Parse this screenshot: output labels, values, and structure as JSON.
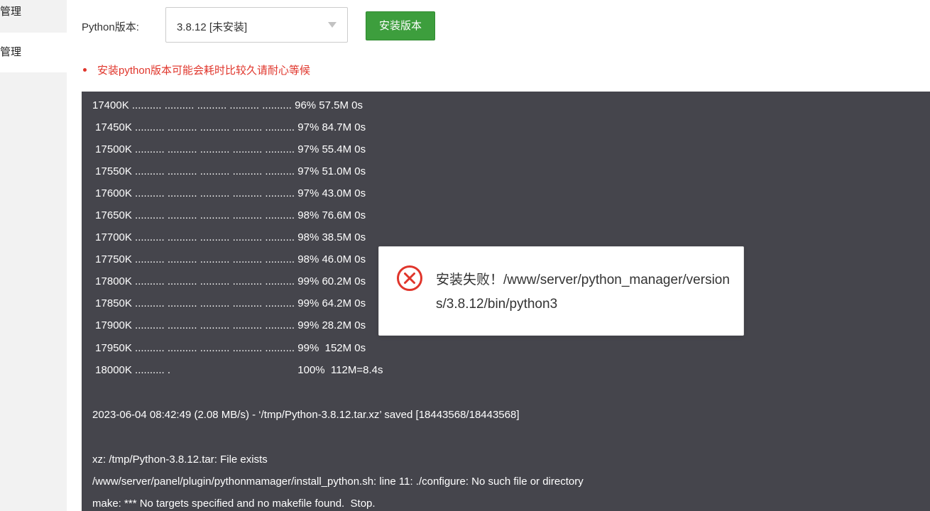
{
  "sidebar": {
    "items": [
      {
        "label": "管理"
      },
      {
        "label": "管理"
      }
    ]
  },
  "version": {
    "label": "Python版本:",
    "selected": "3.8.12  [未安装]",
    "install_button": "安装版本"
  },
  "tip": "安装python版本可能会耗时比较久请耐心等候",
  "log": {
    "lines": [
      "17400K .......... .......... .......... .......... .......... 96% 57.5M 0s",
      " 17450K .......... .......... .......... .......... .......... 97% 84.7M 0s",
      " 17500K .......... .......... .......... .......... .......... 97% 55.4M 0s",
      " 17550K .......... .......... .......... .......... .......... 97% 51.0M 0s",
      " 17600K .......... .......... .......... .......... .......... 97% 43.0M 0s",
      " 17650K .......... .......... .......... .......... .......... 98% 76.6M 0s",
      " 17700K .......... .......... .......... .......... .......... 98% 38.5M 0s",
      " 17750K .......... .......... .......... .......... .......... 98% 46.0M 0s",
      " 17800K .......... .......... .......... .......... .......... 99% 60.2M 0s",
      " 17850K .......... .......... .......... .......... .......... 99% 64.2M 0s",
      " 17900K .......... .......... .......... .......... .......... 99% 28.2M 0s",
      " 17950K .......... .......... .......... .......... .......... 99%  152M 0s",
      " 18000K .......... .                                           100%  112M=8.4s",
      "",
      "2023-06-04 08:42:49 (2.08 MB/s) - ‘/tmp/Python-3.8.12.tar.xz’ saved [18443568/18443568]",
      "",
      "xz: /tmp/Python-3.8.12.tar: File exists",
      "/www/server/panel/plugin/pythonmamager/install_python.sh: line 11: ./configure: No such file or directory",
      "make: *** No targets specified and no makefile found.  Stop."
    ]
  },
  "toast": {
    "message": "安装失败！/www/server/python_manager/versions/3.8.12/bin/python3",
    "icon": "close-circle-icon",
    "icon_color": "#e0352b"
  },
  "colors": {
    "log_background": "#45454c",
    "button_green": "#3d9e3d",
    "tip_red": "#e0352b"
  }
}
